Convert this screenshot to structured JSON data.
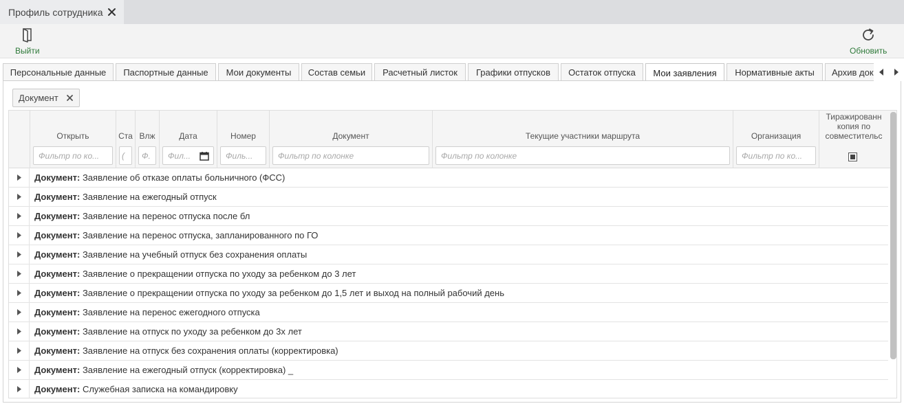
{
  "window_tab": {
    "title": "Профиль сотрудника"
  },
  "toolbar": {
    "exit_label": "Выйти",
    "refresh_label": "Обновить"
  },
  "tabs": [
    {
      "label": "Персональные данные"
    },
    {
      "label": "Паспортные данные"
    },
    {
      "label": "Мои документы"
    },
    {
      "label": "Состав семьи"
    },
    {
      "label": "Расчетный листок"
    },
    {
      "label": "Графики отпусков"
    },
    {
      "label": "Остаток отпуска"
    },
    {
      "label": "Мои заявления"
    },
    {
      "label": "Нормативные акты"
    },
    {
      "label": "Архив док"
    }
  ],
  "active_tab": "Мои заявления",
  "group_chip": {
    "label": "Документ"
  },
  "grid": {
    "columns": [
      {
        "title": "",
        "filter": ""
      },
      {
        "title": "Открыть",
        "filter": "Фильтр по ко..."
      },
      {
        "title": "Ста",
        "filter": "("
      },
      {
        "title": "Влж",
        "filter": "Ф."
      },
      {
        "title": "Дата",
        "filter": "Фил..."
      },
      {
        "title": "Номер",
        "filter": "Филь..."
      },
      {
        "title": "Документ",
        "filter": "Фильтр по колонке"
      },
      {
        "title": "Текущие участники маршрута",
        "filter": "Фильтр по колонке"
      },
      {
        "title": "Организация",
        "filter": "Фильтр по ко..."
      },
      {
        "title": "Тиражированн копия по совместительс",
        "filter": ""
      }
    ],
    "group_prefix": "Документ:",
    "rows": [
      {
        "value": "Заявление об отказе оплаты больничного (ФСС)"
      },
      {
        "value": "Заявление на ежегодный отпуск"
      },
      {
        "value": "Заявление на перенос отпуска после бл"
      },
      {
        "value": "Заявление на перенос отпуска, запланированного по ГО"
      },
      {
        "value": "Заявление на учебный отпуск без сохранения оплаты"
      },
      {
        "value": "Заявление о прекращении отпуска по уходу за ребенком до 3 лет"
      },
      {
        "value": "Заявление о прекращении отпуска по уходу за ребенком до 1,5 лет и выход на полный рабочий день"
      },
      {
        "value": "Заявление на перенос ежегодного отпуска"
      },
      {
        "value": "Заявление на отпуск по уходу за ребенком до 3х лет"
      },
      {
        "value": "Заявление на отпуск без сохранения оплаты (корректировка)"
      },
      {
        "value": "Заявление на ежегодный отпуск (корректировка) _"
      },
      {
        "value": "Служебная записка на командировку"
      }
    ]
  },
  "colors": {
    "accent_green": "#2f7a3a",
    "tab_strip": "#dcdde0"
  }
}
